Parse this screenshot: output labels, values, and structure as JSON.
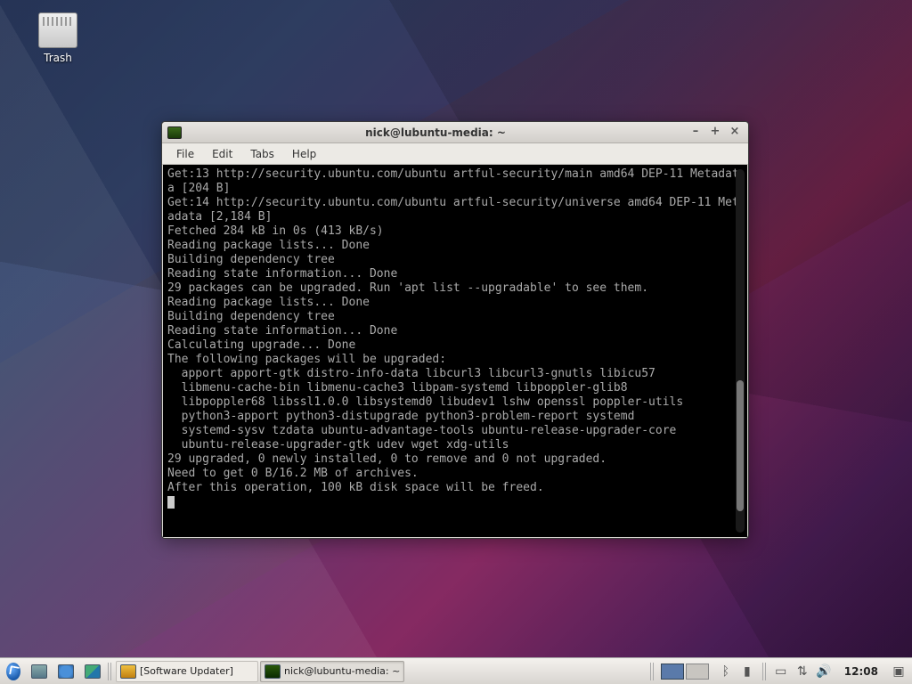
{
  "desktop": {
    "trash_label": "Trash"
  },
  "window": {
    "title": "nick@lubuntu-media: ~",
    "menu": {
      "file": "File",
      "edit": "Edit",
      "tabs": "Tabs",
      "help": "Help"
    }
  },
  "terminal": {
    "lines": [
      "Get:13 http://security.ubuntu.com/ubuntu artful-security/main amd64 DEP-11 Metadata [204 B]",
      "Get:14 http://security.ubuntu.com/ubuntu artful-security/universe amd64 DEP-11 Metadata [2,184 B]",
      "Fetched 284 kB in 0s (413 kB/s)",
      "Reading package lists... Done",
      "Building dependency tree",
      "Reading state information... Done",
      "29 packages can be upgraded. Run 'apt list --upgradable' to see them.",
      "Reading package lists... Done",
      "Building dependency tree",
      "Reading state information... Done",
      "Calculating upgrade... Done",
      "The following packages will be upgraded:",
      "  apport apport-gtk distro-info-data libcurl3 libcurl3-gnutls libicu57",
      "  libmenu-cache-bin libmenu-cache3 libpam-systemd libpoppler-glib8",
      "  libpoppler68 libssl1.0.0 libsystemd0 libudev1 lshw openssl poppler-utils",
      "  python3-apport python3-distupgrade python3-problem-report systemd",
      "  systemd-sysv tzdata ubuntu-advantage-tools ubuntu-release-upgrader-core",
      "  ubuntu-release-upgrader-gtk udev wget xdg-utils",
      "29 upgraded, 0 newly installed, 0 to remove and 0 not upgraded.",
      "Need to get 0 B/16.2 MB of archives.",
      "After this operation, 100 kB disk space will be freed."
    ]
  },
  "taskbar": {
    "task1_label": "[Software Updater]",
    "task2_label": "nick@lubuntu-media: ~",
    "clock": "12:08"
  }
}
